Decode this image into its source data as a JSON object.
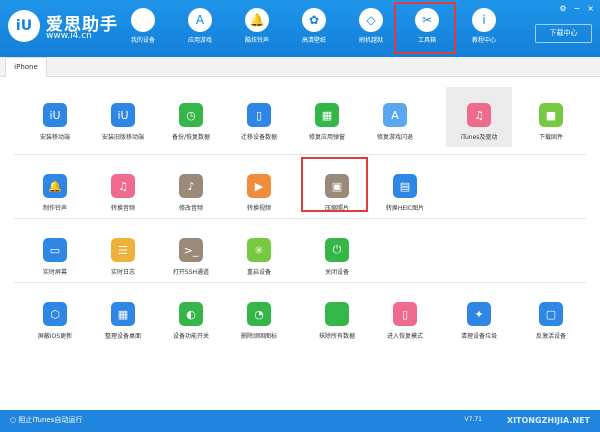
{
  "header": {
    "logo_title": "爱思助手",
    "logo_url": "www.i4.cn",
    "download_center": "下载中心",
    "nav": [
      {
        "label": "我的设备",
        "icon": "apple-icon"
      },
      {
        "label": "应用游戏",
        "icon": "app-store-icon"
      },
      {
        "label": "酷炫铃声",
        "icon": "bell-icon"
      },
      {
        "label": "高清壁纸",
        "icon": "flower-icon"
      },
      {
        "label": "刷机越狱",
        "icon": "dropbox-icon"
      },
      {
        "label": "工具箱",
        "icon": "tools-icon"
      },
      {
        "label": "教程中心",
        "icon": "info-icon"
      }
    ]
  },
  "tab": "iPhone",
  "tools": {
    "row1": [
      "安装移动端",
      "安装旧版移动端",
      "备份/恢复数据",
      "迁移设备数据",
      "修复应用弹窗",
      "修复游戏闪退",
      "iTunes及驱动",
      "下载固件"
    ],
    "row2": [
      "制作铃声",
      "转换音频",
      "修改音频",
      "转换视频",
      "压缩照片",
      "转换HEIC图片"
    ],
    "row3": [
      "实时屏幕",
      "实时日志",
      "打开SSH通道",
      "重启设备",
      "关闭设备"
    ],
    "row4": [
      "屏蔽iOS更新",
      "整理设备桌面",
      "设备功能开关",
      "删除顽固图标",
      "抹除所有数据",
      "进入恢复模式",
      "清理设备垃圾",
      "反激活设备"
    ]
  },
  "colors": {
    "header_blue": "#1683dd",
    "highlight_red": "#e23b3b",
    "tile_blue": "#2f86e4",
    "tile_green": "#34b648",
    "tile_pink": "#ef6b8d",
    "tile_orange": "#f08d3c",
    "tile_gray": "#9b8a7a",
    "tile_purple": "#b06fe0",
    "tile_lightgreen": "#76c940"
  },
  "footer": {
    "itunes_autorun": "阻止iTunes自动运行",
    "version": "V7.71",
    "watermark": "XITONGZHIJIA.NET"
  }
}
